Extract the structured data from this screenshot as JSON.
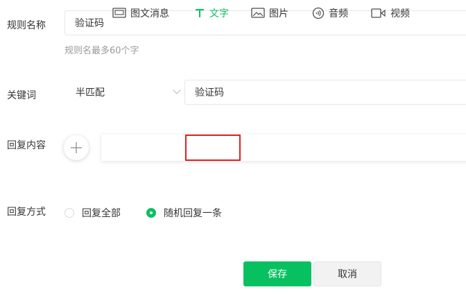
{
  "form": {
    "rule_name": {
      "label": "规则名称",
      "value": "验证码",
      "hint": "规则名最多60个字"
    },
    "keyword": {
      "label": "关键词",
      "match_type": "半匹配",
      "value": "验证码"
    },
    "reply_content": {
      "label": "回复内容",
      "add_icon": "plus-icon",
      "types": [
        {
          "label": "图文消息",
          "icon": "news-icon"
        },
        {
          "label": "文字",
          "icon": "text-icon",
          "active": true
        },
        {
          "label": "图片",
          "icon": "image-icon"
        },
        {
          "label": "音频",
          "icon": "audio-icon"
        },
        {
          "label": "视频",
          "icon": "video-icon"
        }
      ]
    },
    "reply_mode": {
      "label": "回复方式",
      "options": [
        {
          "label": "回复全部",
          "checked": false
        },
        {
          "label": "随机回复一条",
          "checked": true
        }
      ]
    }
  },
  "actions": {
    "save_label": "保存",
    "cancel_label": "取消"
  },
  "colors": {
    "accent": "#07c160",
    "highlight": "#e0201e"
  }
}
